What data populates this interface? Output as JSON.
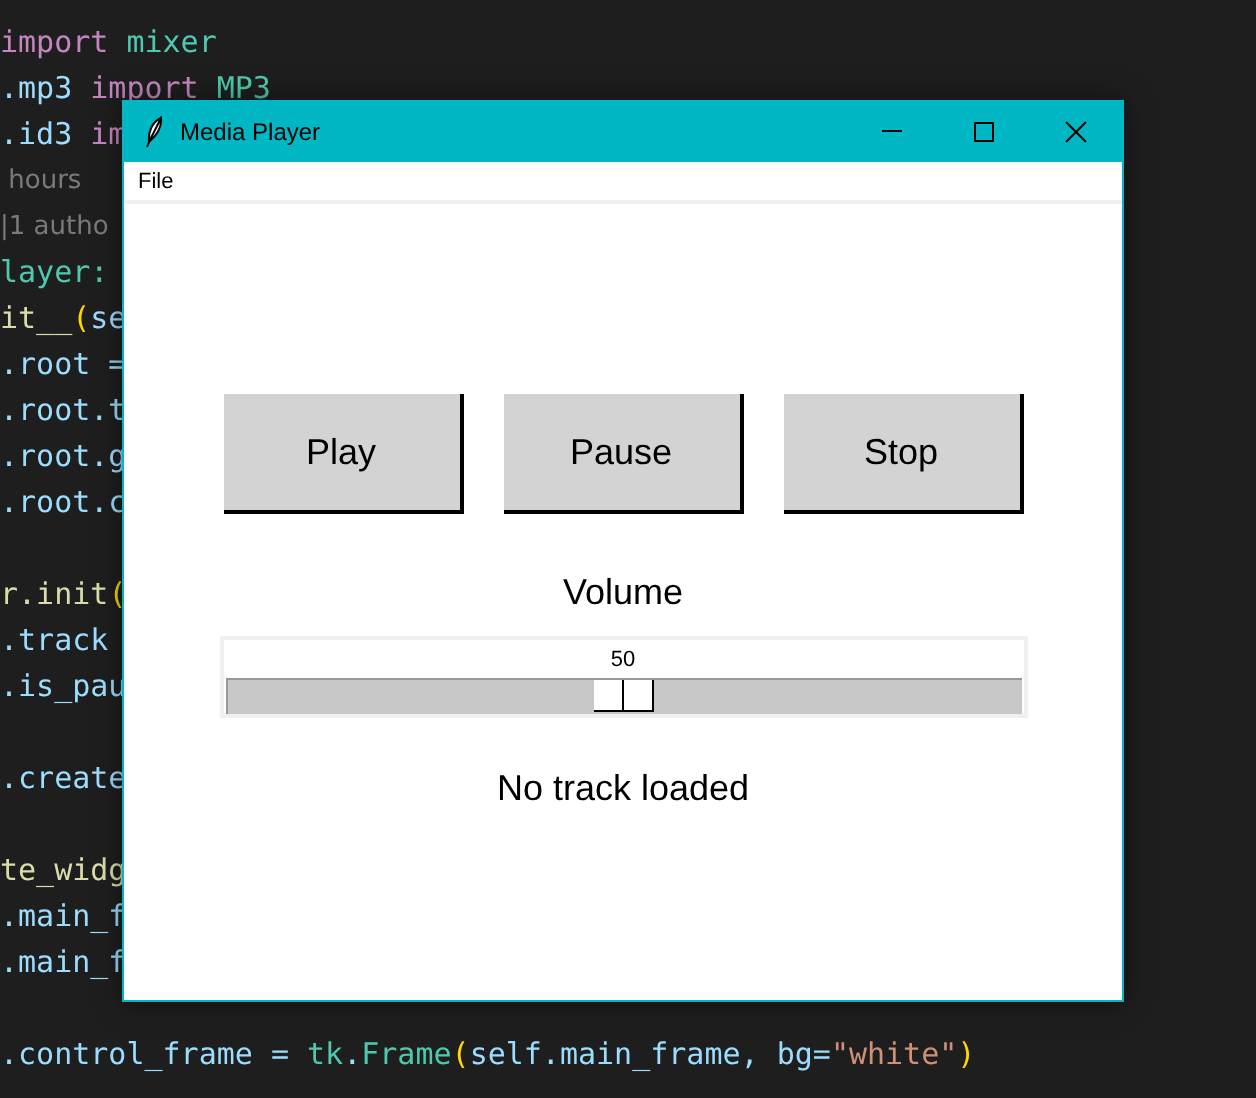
{
  "editor": {
    "blocks": [
      {
        "lines": [
          {
            "tokens": [
              {
                "text": "import",
                "kind": "keyword"
              },
              {
                "text": " mixer",
                "kind": "module"
              }
            ]
          },
          {
            "tokens": [
              {
                "text": ".mp3 ",
                "kind": "name"
              },
              {
                "text": "import",
                "kind": "keyword"
              },
              {
                "text": " MP3",
                "kind": "module"
              }
            ]
          },
          {
            "tokens": [
              {
                "text": ".id3 ",
                "kind": "name"
              },
              {
                "text": "im",
                "kind": "keyword"
              }
            ]
          },
          {
            "tokens": [
              {
                "text": " hours",
                "kind": "lens"
              }
            ]
          },
          {
            "tokens": [
              {
                "text": "|1 autho",
                "kind": "lens"
              }
            ]
          },
          {
            "tokens": [
              {
                "text": "layer:",
                "kind": "module"
              }
            ]
          },
          {
            "tokens": [
              {
                "text": "it__",
                "kind": "func"
              },
              {
                "text": "(",
                "kind": "paren"
              },
              {
                "text": "se",
                "kind": "name"
              }
            ]
          },
          {
            "tokens": [
              {
                "text": ".root =",
                "kind": "name"
              }
            ]
          },
          {
            "tokens": [
              {
                "text": ".root.t",
                "kind": "name"
              }
            ]
          },
          {
            "tokens": [
              {
                "text": ".root.g",
                "kind": "name"
              }
            ]
          },
          {
            "tokens": [
              {
                "text": ".root.c",
                "kind": "name"
              }
            ]
          }
        ]
      },
      {
        "lines": [
          {
            "tokens": [
              {
                "text": "r.init",
                "kind": "func"
              },
              {
                "text": "(",
                "kind": "paren"
              }
            ]
          },
          {
            "tokens": [
              {
                "text": ".track",
                "kind": "name"
              }
            ]
          },
          {
            "tokens": [
              {
                "text": ".is_pau",
                "kind": "name"
              }
            ]
          }
        ]
      },
      {
        "lines": [
          {
            "tokens": [
              {
                "text": ".create",
                "kind": "name"
              }
            ]
          }
        ]
      },
      {
        "lines": [
          {
            "tokens": [
              {
                "text": "te_widg",
                "kind": "func"
              }
            ]
          },
          {
            "tokens": [
              {
                "text": ".main_f",
                "kind": "name"
              }
            ]
          },
          {
            "tokens": [
              {
                "text": ".main_f",
                "kind": "name"
              }
            ]
          }
        ]
      },
      {
        "lines": [
          {
            "tokens": [
              {
                "text": ".control_frame = ",
                "kind": "name"
              },
              {
                "text": "tk",
                "kind": "module"
              },
              {
                "text": ".",
                "kind": "name"
              },
              {
                "text": "Frame",
                "kind": "module"
              },
              {
                "text": "(",
                "kind": "paren"
              },
              {
                "text": "self.main_frame, bg=",
                "kind": "name"
              },
              {
                "text": "\"white\"",
                "kind": "string"
              },
              {
                "text": ")",
                "kind": "paren"
              }
            ]
          }
        ]
      }
    ]
  },
  "window": {
    "title": "Media Player",
    "menu": [
      "File"
    ],
    "buttons": [
      "Play",
      "Pause",
      "Stop"
    ],
    "volume": {
      "label": "Volume",
      "reading": "50",
      "level": 0.5
    },
    "status": "No track loaded"
  }
}
